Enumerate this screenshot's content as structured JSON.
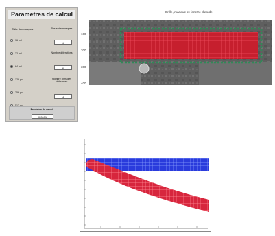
{
  "panel": {
    "title": "Parametres de calcul",
    "col_left_title": "Taille des masques",
    "options": [
      "16 pxl",
      "32 pxl",
      "64 pxl",
      "128 pxl",
      "256 pxl",
      "512 pxl"
    ],
    "selected_index": 2,
    "col_right": [
      {
        "label": "Pas entre masques",
        "value": "16"
      },
      {
        "label": "Nombre d'iterations",
        "value": "6"
      },
      {
        "label": "Nombre d'images deformees",
        "value": "4"
      }
    ],
    "precision_label": "Precision du calcul",
    "precision_value": "0.0001"
  },
  "image_view": {
    "title": "Grille, masque et fenetre d'etude",
    "y_ticks": [
      "100",
      "200",
      "300",
      "400"
    ]
  },
  "colors": {
    "panel_bg": "#d4d0c8",
    "grid_red": "#d7263d",
    "grid_green": "#2e8b57",
    "grid_blue": "#1f3bd8"
  }
}
